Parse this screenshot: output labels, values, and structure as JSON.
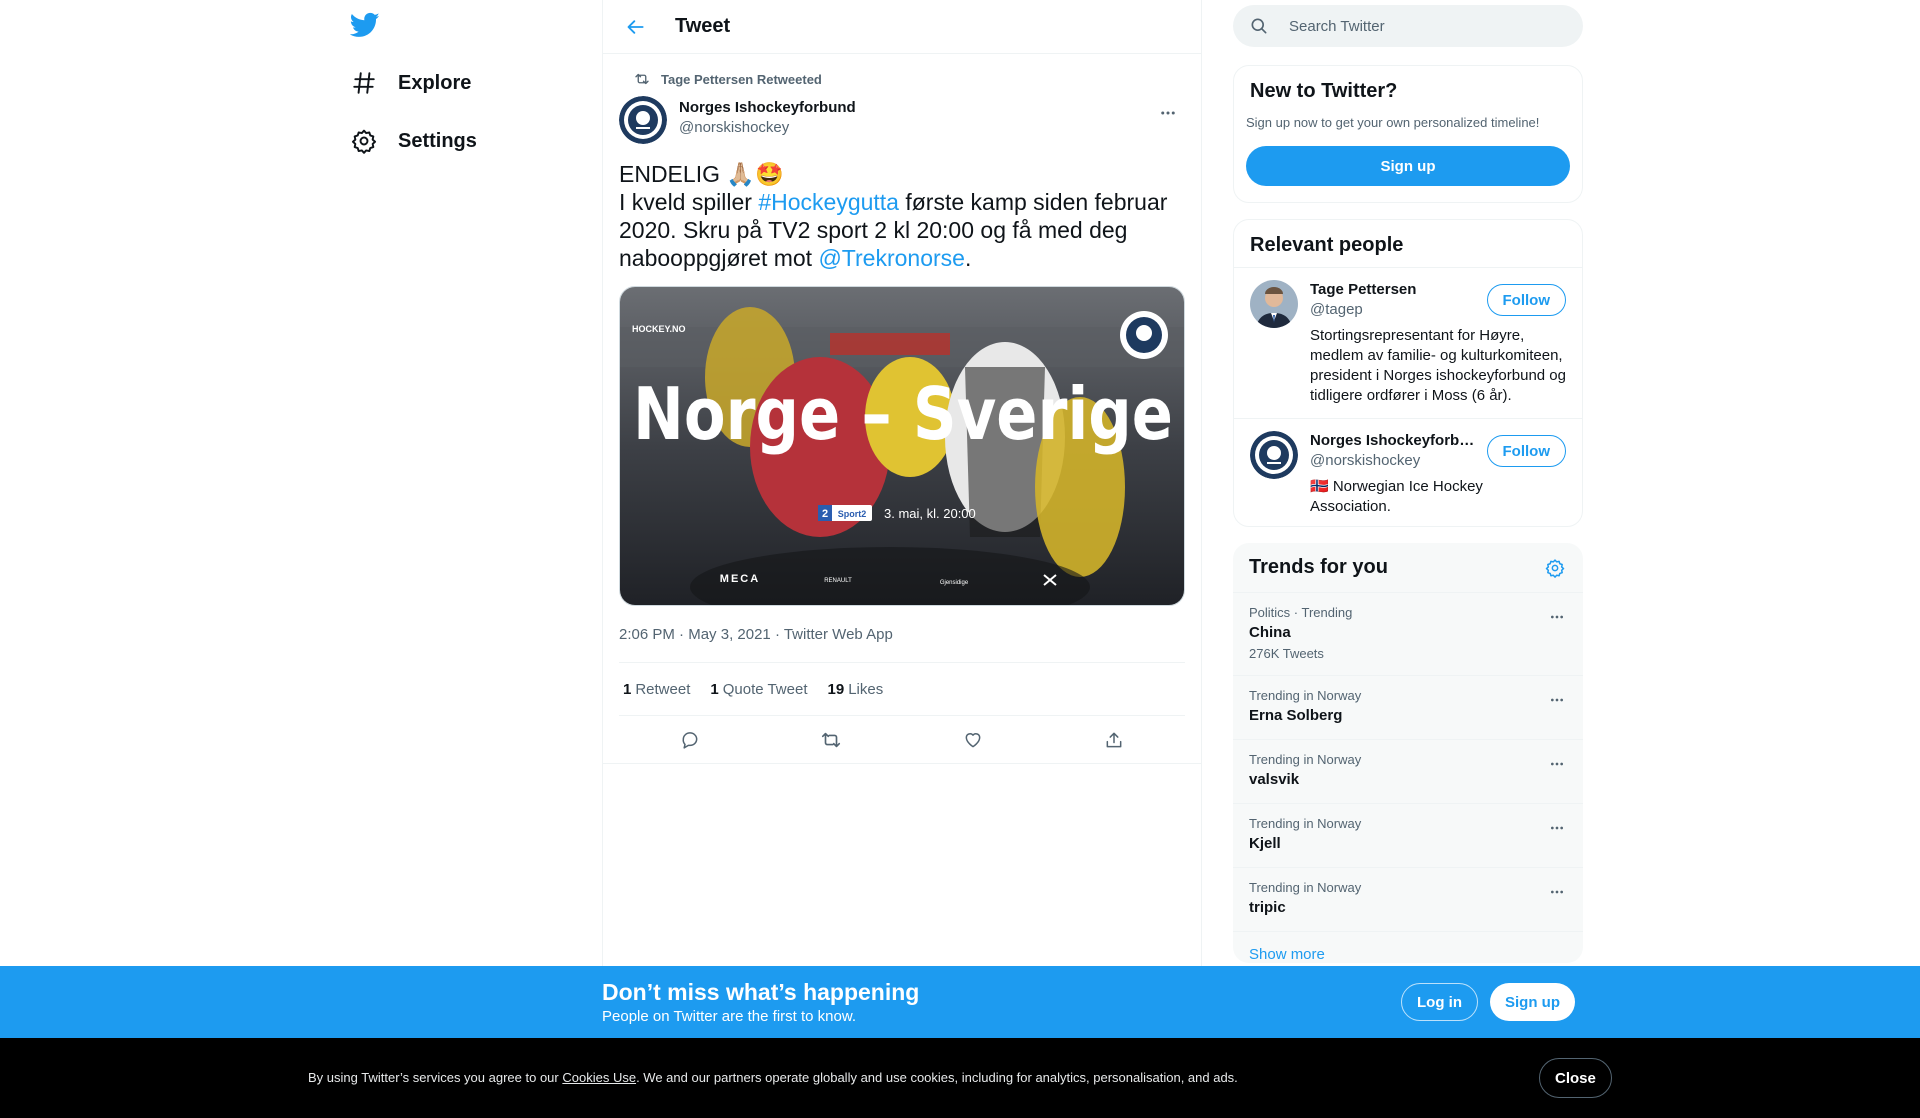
{
  "nav": {
    "items": [
      {
        "label": "Explore",
        "icon": "hashtag-icon"
      },
      {
        "label": "Settings",
        "icon": "gear-icon"
      }
    ]
  },
  "header": {
    "title": "Tweet"
  },
  "tweet": {
    "retweet_context": "Tage Pettersen Retweeted",
    "author_name": "Norges Ishockeyforbund",
    "author_handle": "@norskishockey",
    "line1": "ENDELIG 🙏🏼🤩",
    "line2_pre": "I kveld spiller ",
    "hashtag": "#Hockeygutta",
    "line2_post": " første kamp siden februar 2020. Skru på TV2 sport 2 kl 20:00 og få med deg nabooppgjøret mot ",
    "mention": "@Trekronorse",
    "end": ".",
    "media": {
      "headline": "Norge – Sverige",
      "channel_num": "2",
      "channel": "Sport2",
      "date_text": "3. mai, kl. 20:00",
      "brand": "HOCKEY.NO",
      "sponsor1": "MECA",
      "sponsor2": "RENAULT",
      "sponsor3": "Gjensidige"
    },
    "time": "2:06 PM",
    "date": "May 3, 2021",
    "source": "Twitter Web App",
    "retweets_count": "1",
    "retweets_label": "Retweet",
    "quotes_count": "1",
    "quotes_label": "Quote Tweet",
    "likes_count": "19",
    "likes_label": "Likes"
  },
  "search": {
    "placeholder": "Search Twitter"
  },
  "new_to_twitter": {
    "title": "New to Twitter?",
    "subtitle": "Sign up now to get your own personalized timeline!",
    "button": "Sign up"
  },
  "relevant_people": {
    "title": "Relevant people",
    "people": [
      {
        "name": "Tage Pettersen",
        "handle": "@tagep",
        "bio": "Stortingsrepresentant for Høyre, medlem av familie- og kulturkomiteen, president i Norges ishockeyforbund og tidligere ordfører i Moss (6 år).",
        "follow": "Follow"
      },
      {
        "name": "Norges Ishockeyforbund",
        "handle": "@norskishockey",
        "bio": "🇳🇴 Norwegian Ice Hockey Association.",
        "follow": "Follow"
      }
    ]
  },
  "trends": {
    "title": "Trends for you",
    "items": [
      {
        "meta": "Politics · Trending",
        "name": "China",
        "count": "276K Tweets"
      },
      {
        "meta": "Trending in Norway",
        "name": "Erna Solberg",
        "count": ""
      },
      {
        "meta": "Trending in Norway",
        "name": "valsvik",
        "count": ""
      },
      {
        "meta": "Trending in Norway",
        "name": "Kjell",
        "count": ""
      },
      {
        "meta": "Trending in Norway",
        "name": "tripic",
        "count": ""
      }
    ],
    "show_more": "Show more"
  },
  "banner": {
    "title": "Don’t miss what’s happening",
    "subtitle": "People on Twitter are the first to know.",
    "login": "Log in",
    "signup": "Sign up"
  },
  "cookie": {
    "pre": "By using Twitter’s services you agree to our ",
    "link": "Cookies Use",
    "post": ". We and our partners operate globally and use cookies, including for analytics, personalisation, and ads.",
    "close": "Close"
  },
  "colors": {
    "accent": "#1d9bf0",
    "text": "#0f1419",
    "muted": "#536471"
  }
}
